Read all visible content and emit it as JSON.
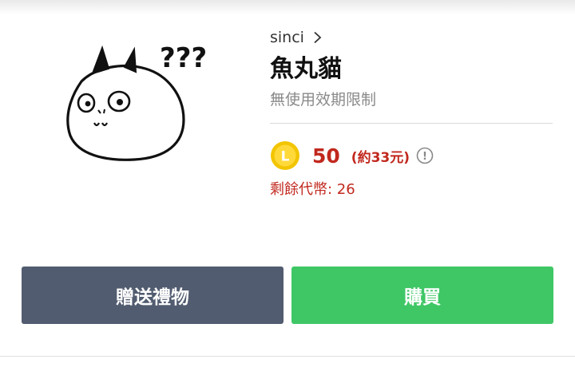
{
  "sticker": {
    "question_marks": "???",
    "icon": "cat-fishball-sticker"
  },
  "author": {
    "name": "sinci",
    "chevron_icon": "chevron-right-icon"
  },
  "product": {
    "title": "魚丸貓",
    "validity": "無使用效期限制"
  },
  "price": {
    "coin_letter": "L",
    "amount": "50",
    "approx": "(約33元)",
    "info_icon_glyph": "!",
    "remaining": "剩餘代幣: 26"
  },
  "buttons": {
    "gift_label": "贈送禮物",
    "buy_label": "購買"
  },
  "colors": {
    "price_red": "#c1281e",
    "gift_button": "#525c70",
    "buy_button": "#3fc766",
    "coin_yellow": "#f2c500"
  }
}
